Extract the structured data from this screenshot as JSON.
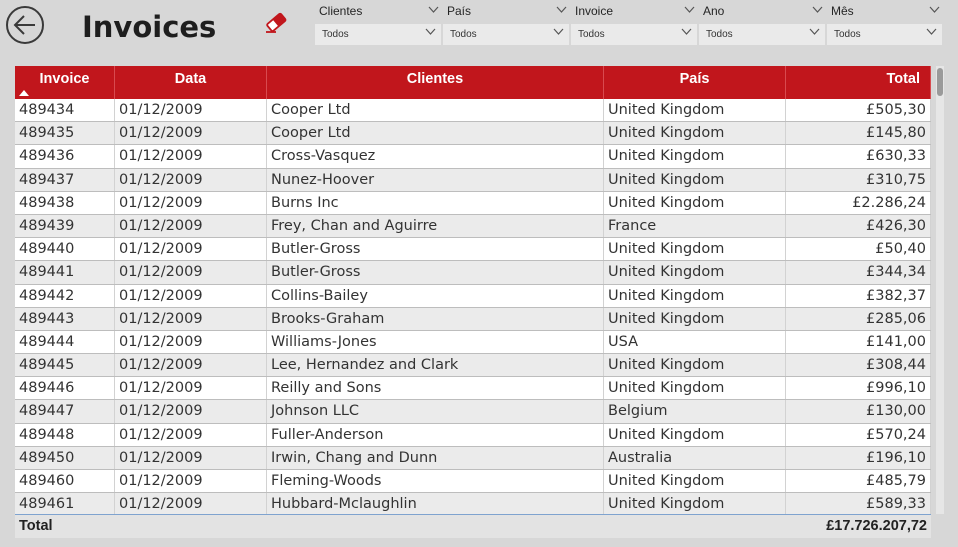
{
  "header": {
    "title": "Invoices"
  },
  "filters": [
    {
      "label": "Clientes",
      "value": "Todos"
    },
    {
      "label": "País",
      "value": "Todos"
    },
    {
      "label": "Invoice",
      "value": "Todos"
    },
    {
      "label": "Ano",
      "value": "Todos"
    },
    {
      "label": "Mês",
      "value": "Todos"
    }
  ],
  "table": {
    "columns": [
      "Invoice",
      "Data",
      "Clientes",
      "País",
      "Total"
    ],
    "sort_column": "Invoice",
    "sort_direction": "ascending",
    "rows": [
      [
        "489434",
        "01/12/2009",
        "Cooper Ltd",
        "United Kingdom",
        "£505,30"
      ],
      [
        "489435",
        "01/12/2009",
        "Cooper Ltd",
        "United Kingdom",
        "£145,80"
      ],
      [
        "489436",
        "01/12/2009",
        "Cross-Vasquez",
        "United Kingdom",
        "£630,33"
      ],
      [
        "489437",
        "01/12/2009",
        "Nunez-Hoover",
        "United Kingdom",
        "£310,75"
      ],
      [
        "489438",
        "01/12/2009",
        "Burns Inc",
        "United Kingdom",
        "£2.286,24"
      ],
      [
        "489439",
        "01/12/2009",
        "Frey, Chan and Aguirre",
        "France",
        "£426,30"
      ],
      [
        "489440",
        "01/12/2009",
        "Butler-Gross",
        "United Kingdom",
        "£50,40"
      ],
      [
        "489441",
        "01/12/2009",
        "Butler-Gross",
        "United Kingdom",
        "£344,34"
      ],
      [
        "489442",
        "01/12/2009",
        "Collins-Bailey",
        "United Kingdom",
        "£382,37"
      ],
      [
        "489443",
        "01/12/2009",
        "Brooks-Graham",
        "United Kingdom",
        "£285,06"
      ],
      [
        "489444",
        "01/12/2009",
        "Williams-Jones",
        "USA",
        "£141,00"
      ],
      [
        "489445",
        "01/12/2009",
        "Lee, Hernandez and Clark",
        "United Kingdom",
        "£308,44"
      ],
      [
        "489446",
        "01/12/2009",
        "Reilly and Sons",
        "United Kingdom",
        "£996,10"
      ],
      [
        "489447",
        "01/12/2009",
        "Johnson LLC",
        "Belgium",
        "£130,00"
      ],
      [
        "489448",
        "01/12/2009",
        "Fuller-Anderson",
        "United Kingdom",
        "£570,24"
      ],
      [
        "489450",
        "01/12/2009",
        "Irwin, Chang and Dunn",
        "Australia",
        "£196,10"
      ],
      [
        "489460",
        "01/12/2009",
        "Fleming-Woods",
        "United Kingdom",
        "£485,79"
      ],
      [
        "489461",
        "01/12/2009",
        "Hubbard-Mclaughlin",
        "United Kingdom",
        "£589,33"
      ]
    ],
    "total_label": "Total",
    "total_value": "£17.726.207,72"
  },
  "colors": {
    "header_bg": "#c1161c",
    "eraser": "#c1161c",
    "page_bg": "#d7d7d7"
  },
  "icons": {
    "back": "back-arrow-circle-icon",
    "clear_filters": "eraser-icon",
    "dropdown": "chevron-down-icon"
  }
}
